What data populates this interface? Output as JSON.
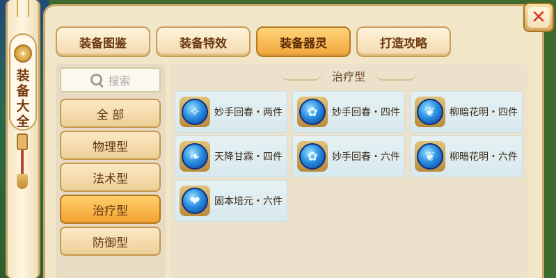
{
  "window": {
    "spine_title": "装备大全",
    "close_label": "✕"
  },
  "tabs": [
    {
      "label": "装备图鉴",
      "active": false
    },
    {
      "label": "装备特效",
      "active": false
    },
    {
      "label": "装备器灵",
      "active": true
    },
    {
      "label": "打造攻略",
      "active": false
    }
  ],
  "search": {
    "placeholder": "搜索"
  },
  "categories": [
    {
      "label": "全 部",
      "active": false
    },
    {
      "label": "物理型",
      "active": false
    },
    {
      "label": "法术型",
      "active": false
    },
    {
      "label": "治疗型",
      "active": true
    },
    {
      "label": "防御型",
      "active": false
    }
  ],
  "section": {
    "title": "治疗型"
  },
  "items": [
    {
      "label": "妙手回春・两件",
      "icon": "feather-icon"
    },
    {
      "label": "妙手回春・四件",
      "icon": "sparkle-flower-icon"
    },
    {
      "label": "柳暗花明・四件",
      "icon": "willow-icon"
    },
    {
      "label": "天降甘霖・四件",
      "icon": "sprout-icon"
    },
    {
      "label": "妙手回春・六件",
      "icon": "sparkle-flower-icon"
    },
    {
      "label": "柳暗花明・六件",
      "icon": "willow-icon"
    },
    {
      "label": "固本培元・六件",
      "icon": "heart-wave-icon"
    }
  ],
  "colors": {
    "tab_active": "#f0a63a",
    "tab_inactive": "#f2d9ac",
    "close_x": "#d53a22",
    "card_bg": "#e6f1f3",
    "icon_blue": "#2b8fe0"
  }
}
